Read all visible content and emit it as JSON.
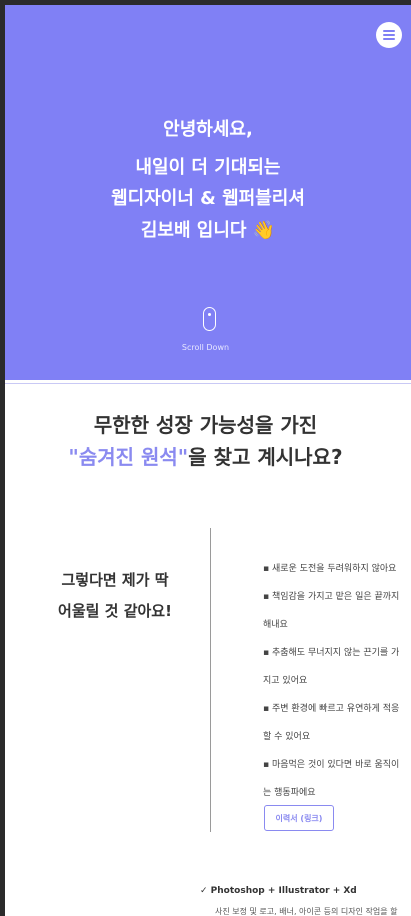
{
  "hero": {
    "line1": "안녕하세요,",
    "line2": "내일이 더 기대되는",
    "line3": "웹디자이너 & 웹퍼블리셔",
    "line4": "김보배 입니다 👋",
    "scroll_label": "Scroll Down",
    "bg_color": "#8080f5"
  },
  "menu": {
    "icon": "hamburger-menu-icon"
  },
  "intro": {
    "headline1": "무한한 성장 가능성을 가진",
    "headline2_accent": "\"숨겨진 원석\"",
    "headline2_rest": "을 찾고 계시나요?",
    "accent_color": "#8a8af0"
  },
  "about": {
    "left_line1": "그렇다면 제가 딱",
    "left_line2": "어울릴 것 같아요!",
    "bullets": [
      "▪ 새로운 도전을 두려워하지 않아요",
      "▪ 책임감을 가지고 맡은 일은 끝까지",
      "해내요",
      "▪ 추춤해도 무너지지 않는 끈기를 가",
      "지고 있어요",
      "▪ 주변 환경에 빠르고 유연하게 적응",
      "할 수 있어요",
      "▪ 마음먹은 것이 있다면 바로 움직이",
      "는 행동파에요"
    ],
    "resume_button": "이력서 (링크)"
  },
  "skills": {
    "title": "✓  Photoshop + Illustrator + Xd",
    "desc": "사진 보정 및 로고, 배너, 아이콘 등의 디자인 작업을 할"
  }
}
